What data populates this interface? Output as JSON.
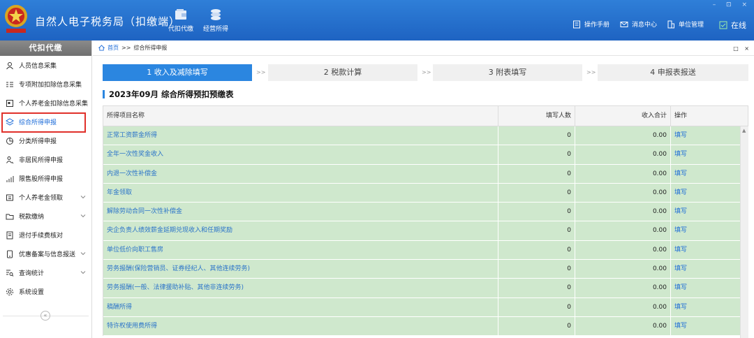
{
  "header": {
    "app_title": "自然人电子税务局（扣缴端）",
    "nav": [
      {
        "label": "代扣代缴",
        "icon": "wallet-icon"
      },
      {
        "label": "经营所得",
        "icon": "coins-icon"
      }
    ],
    "right_items": [
      {
        "label": "操作手册",
        "icon": "manual-icon"
      },
      {
        "label": "消息中心",
        "icon": "message-icon"
      },
      {
        "label": "单位管理",
        "icon": "building-icon"
      }
    ],
    "status": "在线",
    "window_controls": "– ⊡ ×"
  },
  "sidebar": {
    "title": "代扣代缴",
    "items": [
      {
        "label": "人员信息采集",
        "icon": "person-icon",
        "expand": false
      },
      {
        "label": "专项附加扣除信息采集",
        "icon": "list-icon",
        "expand": false
      },
      {
        "label": "个人养老金扣除信息采集",
        "icon": "card-icon",
        "expand": false
      },
      {
        "label": "综合所得申报",
        "icon": "layers-icon",
        "expand": false,
        "active": true
      },
      {
        "label": "分类所得申报",
        "icon": "pie-icon",
        "expand": false
      },
      {
        "label": "非居民所得申报",
        "icon": "person-outline-icon",
        "expand": false
      },
      {
        "label": "限售股所得申报",
        "icon": "bars-icon",
        "expand": false
      },
      {
        "label": "个人养老金领取",
        "icon": "pension-icon",
        "expand": true
      },
      {
        "label": "税款缴纳",
        "icon": "folder-icon",
        "expand": true
      },
      {
        "label": "退付手续费核对",
        "icon": "doc-icon",
        "expand": false
      },
      {
        "label": "优惠备案与信息报送",
        "icon": "phone-icon",
        "expand": true
      },
      {
        "label": "查询统计",
        "icon": "search-list-icon",
        "expand": true
      },
      {
        "label": "系统设置",
        "icon": "gear-icon",
        "expand": false
      }
    ],
    "collapse_symbol": "«"
  },
  "breadcrumb": {
    "home": "首页",
    "sep": ">>",
    "current": "综合所得申报",
    "controls": "□ ×"
  },
  "steps": [
    {
      "label": "1 收入及减除填写",
      "active": true
    },
    {
      "label": "2 税款计算",
      "active": false
    },
    {
      "label": "3 附表填写",
      "active": false
    },
    {
      "label": "4 申报表报送",
      "active": false
    }
  ],
  "step_sep": ">>",
  "section_title": "2023年09月  综合所得预扣预缴表",
  "table": {
    "columns": [
      "所得项目名称",
      "填写人数",
      "收入合计",
      "操作"
    ],
    "rows": [
      {
        "name": "正常工资薪金所得",
        "count": "0",
        "income": "0.00",
        "op": "填写"
      },
      {
        "name": "全年一次性奖金收入",
        "count": "0",
        "income": "0.00",
        "op": "填写"
      },
      {
        "name": "内退一次性补偿金",
        "count": "0",
        "income": "0.00",
        "op": "填写"
      },
      {
        "name": "年金领取",
        "count": "0",
        "income": "0.00",
        "op": "填写"
      },
      {
        "name": "解除劳动合同一次性补偿金",
        "count": "0",
        "income": "0.00",
        "op": "填写"
      },
      {
        "name": "央企负责人绩效薪金延期兑现收入和任期奖励",
        "count": "0",
        "income": "0.00",
        "op": "填写"
      },
      {
        "name": "单位低价向职工售房",
        "count": "0",
        "income": "0.00",
        "op": "填写"
      },
      {
        "name": "劳务报酬(保险营销员、证券经纪人、其他连续劳务)",
        "count": "0",
        "income": "0.00",
        "op": "填写"
      },
      {
        "name": "劳务报酬(一般、法律援助补贴、其他非连续劳务)",
        "count": "0",
        "income": "0.00",
        "op": "填写"
      },
      {
        "name": "稿酬所得",
        "count": "0",
        "income": "0.00",
        "op": "填写"
      },
      {
        "name": "特许权使用费所得",
        "count": "0",
        "income": "0.00",
        "op": "填写"
      }
    ]
  }
}
